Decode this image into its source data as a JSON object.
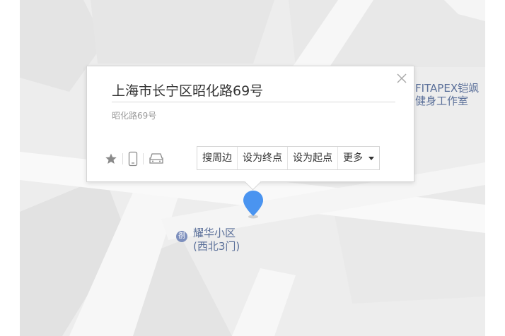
{
  "map": {
    "pois": [
      {
        "name": "FITAPEX铠飒",
        "name2": "健身工作室"
      },
      {
        "name": "耀华小区",
        "name2": "(西北3门)",
        "icon_glyph": "㓢"
      }
    ],
    "pin_color": "#4a94f0",
    "poi_color": "#5a6f99"
  },
  "popup": {
    "title": "上海市长宁区昭化路69号",
    "subtitle": "昭化路69号",
    "icons": [
      "star-icon",
      "phone-icon",
      "taxi-icon"
    ],
    "actions": [
      "搜周边",
      "设为终点",
      "设为起点",
      "更多"
    ]
  }
}
